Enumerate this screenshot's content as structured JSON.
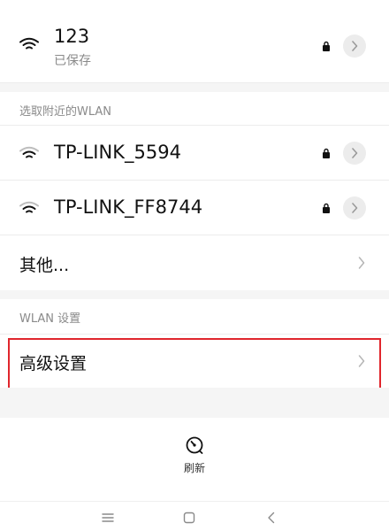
{
  "saved_network": {
    "name": "123",
    "status": "已保存",
    "wifi_icon": "wifi-icon",
    "lock_icon": "lock-icon",
    "detail_icon": "chevron-right-icon"
  },
  "nearby": {
    "section_label": "选取附近的WLAN",
    "networks": [
      {
        "name": "TP-LINK_5594"
      },
      {
        "name": "TP-LINK_FF8744"
      }
    ],
    "other_label": "其他..."
  },
  "settings": {
    "section_label": "WLAN 设置",
    "advanced_label": "高级设置"
  },
  "refresh": {
    "label": "刷新",
    "icon": "refresh-icon"
  },
  "navbar": {
    "menu_icon": "menu-icon",
    "home_icon": "home-icon",
    "back_icon": "back-icon"
  },
  "colors": {
    "highlight": "#e0262d",
    "section_bg": "#f5f5f5",
    "secondary_text": "#8a8a8a"
  }
}
